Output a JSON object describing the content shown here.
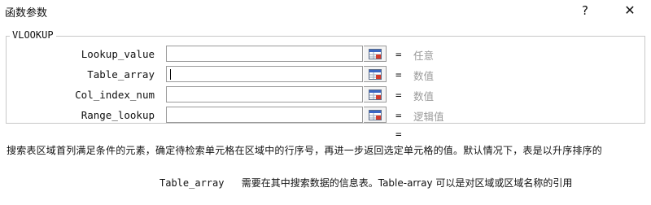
{
  "window": {
    "title": "函数参数",
    "help_label": "?",
    "close_label": "✕"
  },
  "function": {
    "name": "VLOOKUP",
    "args": [
      {
        "label": "Lookup_value",
        "value": "",
        "equals": "=",
        "hint": "任意"
      },
      {
        "label": "Table_array",
        "value": "",
        "equals": "=",
        "hint": "数值"
      },
      {
        "label": "Col_index_num",
        "value": "",
        "equals": "=",
        "hint": "数值"
      },
      {
        "label": "Range_lookup",
        "value": "",
        "equals": "=",
        "hint": "逻辑值"
      }
    ],
    "result_equals": "="
  },
  "description": "搜索表区域首列满足条件的元素，确定待检索单元格在区域中的行序号，再进一步返回选定单元格的值。默认情况下，表是以升序排序的",
  "param_help": {
    "name": "Table_array",
    "text": "需要在其中搜索数据的信息表。Table-array 可以是对区域或区域名称的引用"
  },
  "icons": {
    "ref_button": "collapse-dialog-icon"
  }
}
